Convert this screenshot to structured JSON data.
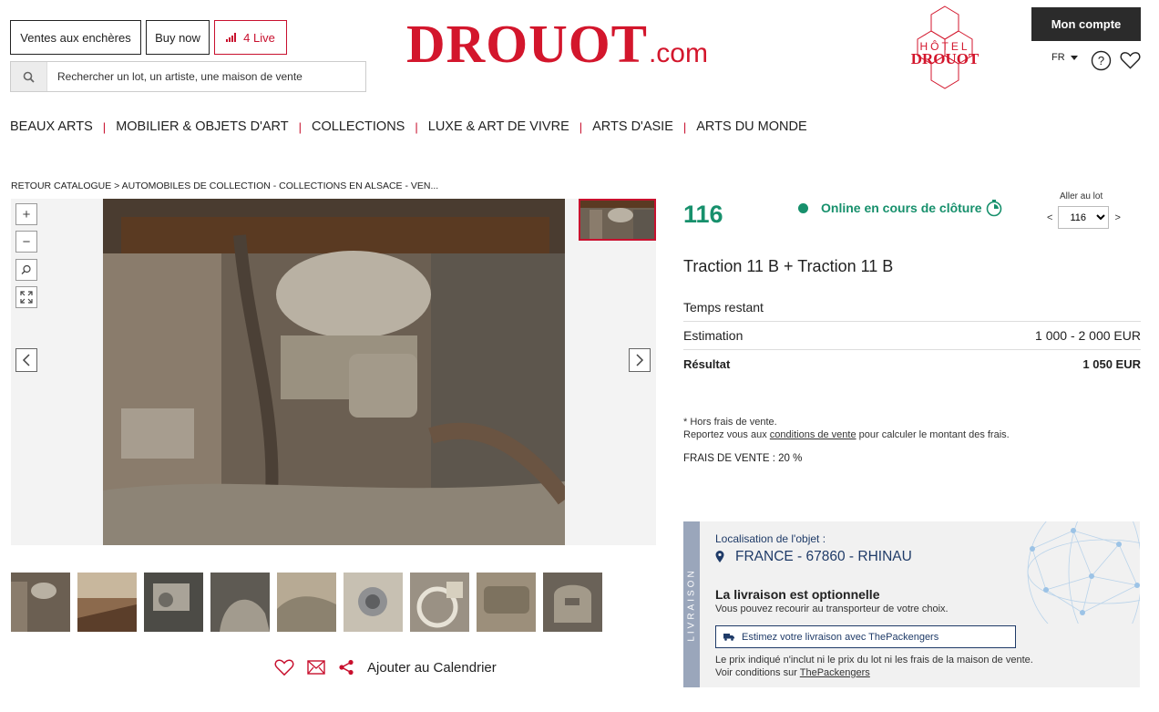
{
  "header": {
    "ventes_label": "Ventes aux enchères",
    "buynow_label": "Buy now",
    "live_label": "4 Live",
    "search_placeholder": "Rechercher un lot, un artiste, une maison de vente",
    "logo_main": "DROUOT",
    "logo_tld": ".com",
    "hotel_logo_line1": "HÔTEL",
    "hotel_logo_line2": "DROUOT",
    "account_label": "Mon compte",
    "lang": "FR",
    "brand_color": "#d3162c"
  },
  "nav": {
    "items": [
      "BEAUX ARTS",
      "MOBILIER & OBJETS D'ART",
      "COLLECTIONS",
      "LUXE & ART DE VIVRE",
      "ARTS D'ASIE",
      "ARTS DU MONDE"
    ]
  },
  "breadcrumb": "RETOUR CATALOGUE > AUTOMOBILES DE COLLECTION - COLLECTIONS EN ALSACE - VEN...",
  "viewer": {
    "zoom_in": "+",
    "zoom_out": "−"
  },
  "actions": {
    "calendar_label": "Ajouter au Calendrier"
  },
  "lot": {
    "number": "116",
    "status": "Online en cours de clôture",
    "status_color": "#17906c",
    "goto_label": "Aller au lot",
    "goto_prev": "<",
    "goto_next": ">",
    "goto_value": "116",
    "title": "Traction 11 B + Traction 11 B",
    "rows": {
      "time_label": "Temps restant",
      "estimate_label": "Estimation",
      "estimate_value": "1 000 - 2 000 EUR",
      "result_label": "Résultat",
      "result_value": "1 050 EUR"
    },
    "fees_note_1": "* Hors frais de vente.",
    "fees_note_2a": "Reportez vous aux ",
    "fees_note_link": "conditions de vente",
    "fees_note_2b": " pour calculer le montant des frais.",
    "frais": "FRAIS DE VENTE : 20 %"
  },
  "delivery": {
    "side_label": "LIVRAISON",
    "location_label": "Localisation de l'objet :",
    "location_value": "FRANCE - 67860 - RHINAU",
    "optional_title": "La livraison est optionnelle",
    "optional_sub": "Vous pouvez recourir au transporteur de votre choix.",
    "estimate_button": "Estimez votre livraison avec ThePackengers",
    "disclaimer_1": "Le prix indiqué n'inclut ni le prix du lot ni les frais de la maison de vente.",
    "disclaimer_2": "Voir conditions sur ",
    "disclaimer_link": "ThePackengers",
    "accent_color": "#1f3b68"
  }
}
